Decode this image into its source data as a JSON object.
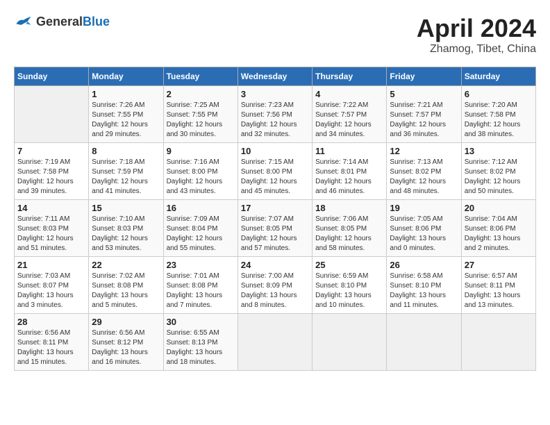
{
  "header": {
    "logo_general": "General",
    "logo_blue": "Blue",
    "month_title": "April 2024",
    "location": "Zhamog, Tibet, China"
  },
  "days_of_week": [
    "Sunday",
    "Monday",
    "Tuesday",
    "Wednesday",
    "Thursday",
    "Friday",
    "Saturday"
  ],
  "weeks": [
    [
      {
        "day": "",
        "empty": true
      },
      {
        "day": "1",
        "sunrise": "Sunrise: 7:26 AM",
        "sunset": "Sunset: 7:55 PM",
        "daylight": "Daylight: 12 hours and 29 minutes."
      },
      {
        "day": "2",
        "sunrise": "Sunrise: 7:25 AM",
        "sunset": "Sunset: 7:55 PM",
        "daylight": "Daylight: 12 hours and 30 minutes."
      },
      {
        "day": "3",
        "sunrise": "Sunrise: 7:23 AM",
        "sunset": "Sunset: 7:56 PM",
        "daylight": "Daylight: 12 hours and 32 minutes."
      },
      {
        "day": "4",
        "sunrise": "Sunrise: 7:22 AM",
        "sunset": "Sunset: 7:57 PM",
        "daylight": "Daylight: 12 hours and 34 minutes."
      },
      {
        "day": "5",
        "sunrise": "Sunrise: 7:21 AM",
        "sunset": "Sunset: 7:57 PM",
        "daylight": "Daylight: 12 hours and 36 minutes."
      },
      {
        "day": "6",
        "sunrise": "Sunrise: 7:20 AM",
        "sunset": "Sunset: 7:58 PM",
        "daylight": "Daylight: 12 hours and 38 minutes."
      }
    ],
    [
      {
        "day": "7",
        "sunrise": "Sunrise: 7:19 AM",
        "sunset": "Sunset: 7:58 PM",
        "daylight": "Daylight: 12 hours and 39 minutes."
      },
      {
        "day": "8",
        "sunrise": "Sunrise: 7:18 AM",
        "sunset": "Sunset: 7:59 PM",
        "daylight": "Daylight: 12 hours and 41 minutes."
      },
      {
        "day": "9",
        "sunrise": "Sunrise: 7:16 AM",
        "sunset": "Sunset: 8:00 PM",
        "daylight": "Daylight: 12 hours and 43 minutes."
      },
      {
        "day": "10",
        "sunrise": "Sunrise: 7:15 AM",
        "sunset": "Sunset: 8:00 PM",
        "daylight": "Daylight: 12 hours and 45 minutes."
      },
      {
        "day": "11",
        "sunrise": "Sunrise: 7:14 AM",
        "sunset": "Sunset: 8:01 PM",
        "daylight": "Daylight: 12 hours and 46 minutes."
      },
      {
        "day": "12",
        "sunrise": "Sunrise: 7:13 AM",
        "sunset": "Sunset: 8:02 PM",
        "daylight": "Daylight: 12 hours and 48 minutes."
      },
      {
        "day": "13",
        "sunrise": "Sunrise: 7:12 AM",
        "sunset": "Sunset: 8:02 PM",
        "daylight": "Daylight: 12 hours and 50 minutes."
      }
    ],
    [
      {
        "day": "14",
        "sunrise": "Sunrise: 7:11 AM",
        "sunset": "Sunset: 8:03 PM",
        "daylight": "Daylight: 12 hours and 51 minutes."
      },
      {
        "day": "15",
        "sunrise": "Sunrise: 7:10 AM",
        "sunset": "Sunset: 8:03 PM",
        "daylight": "Daylight: 12 hours and 53 minutes."
      },
      {
        "day": "16",
        "sunrise": "Sunrise: 7:09 AM",
        "sunset": "Sunset: 8:04 PM",
        "daylight": "Daylight: 12 hours and 55 minutes."
      },
      {
        "day": "17",
        "sunrise": "Sunrise: 7:07 AM",
        "sunset": "Sunset: 8:05 PM",
        "daylight": "Daylight: 12 hours and 57 minutes."
      },
      {
        "day": "18",
        "sunrise": "Sunrise: 7:06 AM",
        "sunset": "Sunset: 8:05 PM",
        "daylight": "Daylight: 12 hours and 58 minutes."
      },
      {
        "day": "19",
        "sunrise": "Sunrise: 7:05 AM",
        "sunset": "Sunset: 8:06 PM",
        "daylight": "Daylight: 13 hours and 0 minutes."
      },
      {
        "day": "20",
        "sunrise": "Sunrise: 7:04 AM",
        "sunset": "Sunset: 8:06 PM",
        "daylight": "Daylight: 13 hours and 2 minutes."
      }
    ],
    [
      {
        "day": "21",
        "sunrise": "Sunrise: 7:03 AM",
        "sunset": "Sunset: 8:07 PM",
        "daylight": "Daylight: 13 hours and 3 minutes."
      },
      {
        "day": "22",
        "sunrise": "Sunrise: 7:02 AM",
        "sunset": "Sunset: 8:08 PM",
        "daylight": "Daylight: 13 hours and 5 minutes."
      },
      {
        "day": "23",
        "sunrise": "Sunrise: 7:01 AM",
        "sunset": "Sunset: 8:08 PM",
        "daylight": "Daylight: 13 hours and 7 minutes."
      },
      {
        "day": "24",
        "sunrise": "Sunrise: 7:00 AM",
        "sunset": "Sunset: 8:09 PM",
        "daylight": "Daylight: 13 hours and 8 minutes."
      },
      {
        "day": "25",
        "sunrise": "Sunrise: 6:59 AM",
        "sunset": "Sunset: 8:10 PM",
        "daylight": "Daylight: 13 hours and 10 minutes."
      },
      {
        "day": "26",
        "sunrise": "Sunrise: 6:58 AM",
        "sunset": "Sunset: 8:10 PM",
        "daylight": "Daylight: 13 hours and 11 minutes."
      },
      {
        "day": "27",
        "sunrise": "Sunrise: 6:57 AM",
        "sunset": "Sunset: 8:11 PM",
        "daylight": "Daylight: 13 hours and 13 minutes."
      }
    ],
    [
      {
        "day": "28",
        "sunrise": "Sunrise: 6:56 AM",
        "sunset": "Sunset: 8:11 PM",
        "daylight": "Daylight: 13 hours and 15 minutes."
      },
      {
        "day": "29",
        "sunrise": "Sunrise: 6:56 AM",
        "sunset": "Sunset: 8:12 PM",
        "daylight": "Daylight: 13 hours and 16 minutes."
      },
      {
        "day": "30",
        "sunrise": "Sunrise: 6:55 AM",
        "sunset": "Sunset: 8:13 PM",
        "daylight": "Daylight: 13 hours and 18 minutes."
      },
      {
        "day": "",
        "empty": true
      },
      {
        "day": "",
        "empty": true
      },
      {
        "day": "",
        "empty": true
      },
      {
        "day": "",
        "empty": true
      }
    ]
  ]
}
